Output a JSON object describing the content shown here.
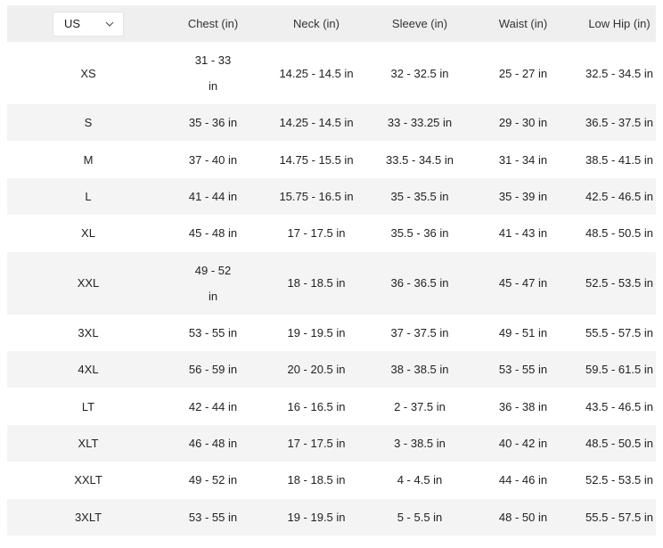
{
  "unit_selector": {
    "selected": "US",
    "icon": "chevron-down-icon"
  },
  "columns": [
    "Chest (in)",
    "Neck (in)",
    "Sleeve (in)",
    "Waist (in)",
    "Low Hip (in)"
  ],
  "rows": [
    {
      "size": "XS",
      "cells": [
        "31 - 33 in",
        "14.25 - 14.5 in",
        "32 - 32.5 in",
        "25 - 27 in",
        "32.5 - 34.5 in"
      ]
    },
    {
      "size": "S",
      "cells": [
        "35 - 36 in",
        "14.25 - 14.5 in",
        "33 - 33.25 in",
        "29 - 30 in",
        "36.5 - 37.5 in"
      ]
    },
    {
      "size": "M",
      "cells": [
        "37 - 40 in",
        "14.75 - 15.5 in",
        "33.5 - 34.5 in",
        "31 - 34 in",
        "38.5 - 41.5 in"
      ]
    },
    {
      "size": "L",
      "cells": [
        "41 - 44 in",
        "15.75 - 16.5 in",
        "35 - 35.5 in",
        "35 - 39 in",
        "42.5 - 46.5 in"
      ]
    },
    {
      "size": "XL",
      "cells": [
        "45 - 48 in",
        "17 - 17.5 in",
        "35.5 - 36 in",
        "41 - 43 in",
        "48.5 - 50.5 in"
      ]
    },
    {
      "size": "XXL",
      "cells": [
        "49 - 52 in",
        "18 - 18.5 in",
        "36 - 36.5 in",
        "45 - 47 in",
        "52.5 - 53.5 in"
      ]
    },
    {
      "size": "3XL",
      "cells": [
        "53 - 55 in",
        "19 - 19.5 in",
        "37 - 37.5 in",
        "49 - 51 in",
        "55.5 - 57.5 in"
      ]
    },
    {
      "size": "4XL",
      "cells": [
        "56 - 59 in",
        "20 - 20.5 in",
        "38 - 38.5 in",
        "53 - 55 in",
        "59.5 - 61.5 in"
      ]
    },
    {
      "size": "LT",
      "cells": [
        "42 - 44 in",
        "16 - 16.5 in",
        "2 - 37.5 in",
        "36 - 38 in",
        "43.5 - 46.5 in"
      ]
    },
    {
      "size": "XLT",
      "cells": [
        "46 - 48 in",
        "17 - 17.5 in",
        "3 - 38.5 in",
        "40 - 42 in",
        "48.5 - 50.5 in"
      ]
    },
    {
      "size": "XXLT",
      "cells": [
        "49 - 52 in",
        "18 - 18.5 in",
        "4 - 4.5 in",
        "44 - 46 in",
        "52.5 - 53.5 in"
      ]
    },
    {
      "size": "3XLT",
      "cells": [
        "53 - 55 in",
        "19 - 19.5 in",
        "5 - 5.5 in",
        "48 - 50 in",
        "55.5 - 57.5 in"
      ]
    }
  ]
}
